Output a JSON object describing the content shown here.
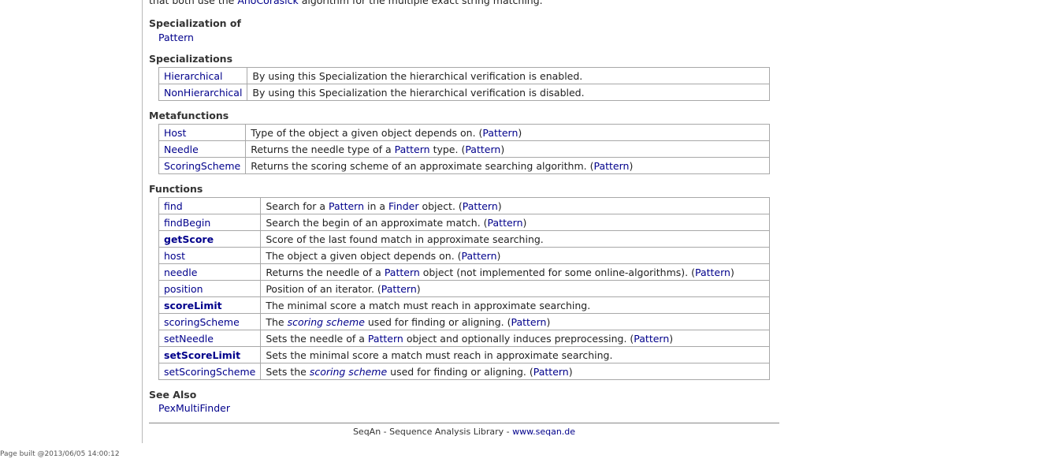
{
  "intro": {
    "prefix": "that both use the ",
    "link": "AhoCorasick",
    "suffix": " algorithm for the multiple exact string matching."
  },
  "specialization_of": {
    "heading": "Specialization of",
    "link": "Pattern"
  },
  "specializations": {
    "heading": "Specializations",
    "rows": [
      {
        "name": "Hierarchical",
        "desc": "By using this Specialization the hierarchical verification is enabled."
      },
      {
        "name": "NonHierarchical",
        "desc": "By using this Specialization the hierarchical verification is disabled."
      }
    ]
  },
  "metafunctions": {
    "heading": "Metafunctions",
    "rows": [
      {
        "name": "Host",
        "desc": "Type of the object a given object depends on. (",
        "ref": "Pattern",
        "end": ")"
      },
      {
        "name": "Needle",
        "desc1": "Returns the needle type of a ",
        "link1": "Pattern",
        "desc2": " type. (",
        "ref": "Pattern",
        "end": ")"
      },
      {
        "name": "ScoringScheme",
        "desc": "Returns the scoring scheme of an approximate searching algorithm. (",
        "ref": "Pattern",
        "end": ")"
      }
    ]
  },
  "functions": {
    "heading": "Functions",
    "rows": [
      {
        "name": "find",
        "d1": "Search for a ",
        "l1": "Pattern",
        "d2": " in a ",
        "l2": "Finder",
        "d3": " object. (",
        "ref": "Pattern",
        "end": ")"
      },
      {
        "name": "findBegin",
        "d1": "Search the begin of an approximate match. (",
        "ref": "Pattern",
        "end": ")"
      },
      {
        "name": "getScore",
        "d1": "Score of the last found match in approximate searching."
      },
      {
        "name": "host",
        "d1": "The object a given object depends on. (",
        "ref": "Pattern",
        "end": ")"
      },
      {
        "name": "needle",
        "d1": "Returns the needle of a ",
        "l1": "Pattern",
        "d2": " object (not implemented for some online-algorithms). (",
        "ref": "Pattern",
        "end": ")"
      },
      {
        "name": "position",
        "d1": "Position of an iterator. (",
        "ref": "Pattern",
        "end": ")"
      },
      {
        "name": "scoreLimit",
        "d1": "The minimal score a match must reach in approximate searching."
      },
      {
        "name": "scoringScheme",
        "d1": "The ",
        "em": "scoring scheme",
        "d2": " used for finding or aligning. (",
        "ref": "Pattern",
        "end": ")"
      },
      {
        "name": "setNeedle",
        "d1": "Sets the needle of a ",
        "l1": "Pattern",
        "d2": " object and optionally induces preprocessing. (",
        "ref": "Pattern",
        "end": ")"
      },
      {
        "name": "setScoreLimit",
        "d1": "Sets the minimal score a match must reach in approximate searching."
      },
      {
        "name": "setScoringScheme",
        "d1": "Sets the ",
        "em": "scoring scheme",
        "d2": " used for finding or aligning. (",
        "ref": "Pattern",
        "end": ")"
      }
    ]
  },
  "see_also": {
    "heading": "See Also",
    "link": "PexMultiFinder"
  },
  "footer": {
    "text": "SeqAn - Sequence Analysis Library - ",
    "link": "www.seqan.de"
  },
  "page_built": "Page built @2013/06/05 14:00:12"
}
